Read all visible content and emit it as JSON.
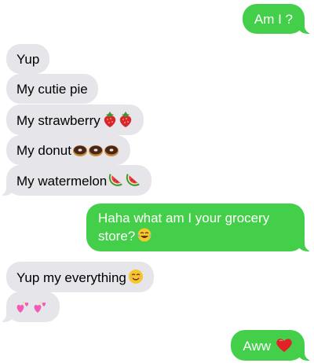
{
  "conversation": {
    "messages": [
      {
        "id": "m1",
        "direction": "outgoing",
        "text": "Am I ?",
        "emoji": []
      },
      {
        "id": "m2",
        "direction": "incoming",
        "text": "Yup",
        "emoji": []
      },
      {
        "id": "m3",
        "direction": "incoming",
        "text": "My cutie pie",
        "emoji": []
      },
      {
        "id": "m4",
        "direction": "incoming",
        "text": "My strawberry",
        "emoji": [
          "strawberry-icon",
          "strawberry-icon"
        ]
      },
      {
        "id": "m5",
        "direction": "incoming",
        "text": "My donut",
        "emoji": [
          "donut-icon",
          "donut-icon",
          "donut-icon"
        ]
      },
      {
        "id": "m6",
        "direction": "incoming",
        "text": "My watermelon",
        "emoji": [
          "watermelon-icon",
          "watermelon-icon"
        ]
      },
      {
        "id": "m7",
        "direction": "outgoing",
        "text": "Haha what am I your grocery store?",
        "emoji": [
          "tears-of-joy-icon"
        ]
      },
      {
        "id": "m8",
        "direction": "incoming",
        "text": "Yup my everything",
        "emoji": [
          "smiling-face-icon"
        ]
      },
      {
        "id": "m9",
        "direction": "incoming",
        "text": "",
        "emoji": [
          "sparkling-hearts-icon",
          "sparkling-hearts-icon"
        ]
      },
      {
        "id": "m10",
        "direction": "outgoing",
        "text": "Aww",
        "emoji": [
          "red-heart-icon"
        ]
      }
    ]
  },
  "colors": {
    "outgoing_bubble": "#43cf4a",
    "incoming_bubble": "#e5e5ea",
    "outgoing_text": "#ffffff",
    "incoming_text": "#000000",
    "background": "#ffffff"
  }
}
